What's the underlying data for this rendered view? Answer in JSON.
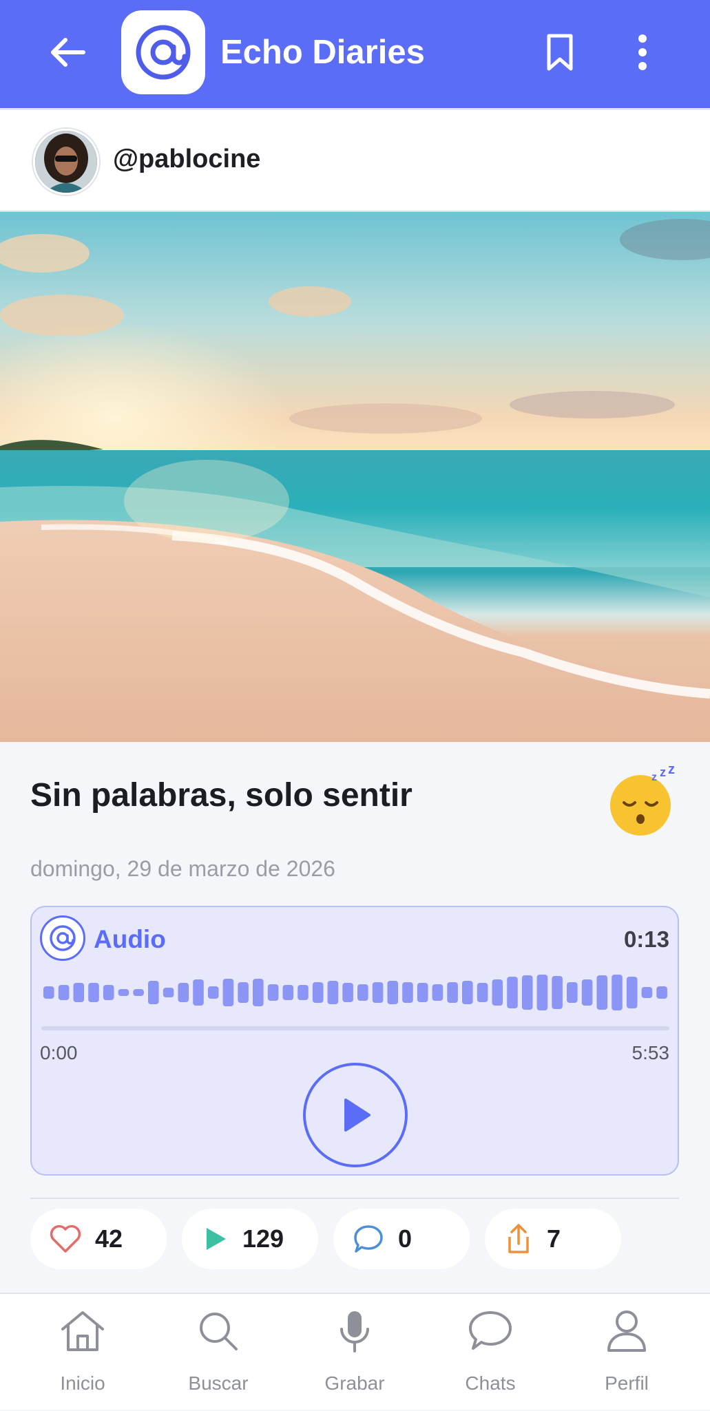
{
  "app": {
    "title": "Echo Diaries"
  },
  "header": {
    "back_icon": "arrow-left-icon",
    "bookmark_icon": "bookmark-icon",
    "more_icon": "more-vertical-icon"
  },
  "user": {
    "handle": "@pablocine"
  },
  "post": {
    "title": "Sin palabras, solo sentir",
    "mood_icon": "sleeping-face-emoji",
    "date": "domingo, 29 de marzo de 2026"
  },
  "audio": {
    "label": "Audio",
    "duration": "0:13",
    "current_time": "0:00",
    "total_time": "5:53",
    "progress": 0
  },
  "stats": {
    "likes": "42",
    "plays": "129",
    "comments": "0",
    "shares": "7"
  },
  "nav": {
    "items": [
      {
        "label": "Inicio",
        "icon": "home-icon"
      },
      {
        "label": "Buscar",
        "icon": "search-icon"
      },
      {
        "label": "Grabar",
        "icon": "microphone-icon"
      },
      {
        "label": "Chats",
        "icon": "chat-icon"
      },
      {
        "label": "Perfil",
        "icon": "user-icon"
      }
    ]
  },
  "colors": {
    "accent": "#5b6cf6",
    "like": "#e56a6a",
    "play": "#3cc0a4",
    "comment": "#4b8fd8",
    "share": "#f0913a"
  }
}
